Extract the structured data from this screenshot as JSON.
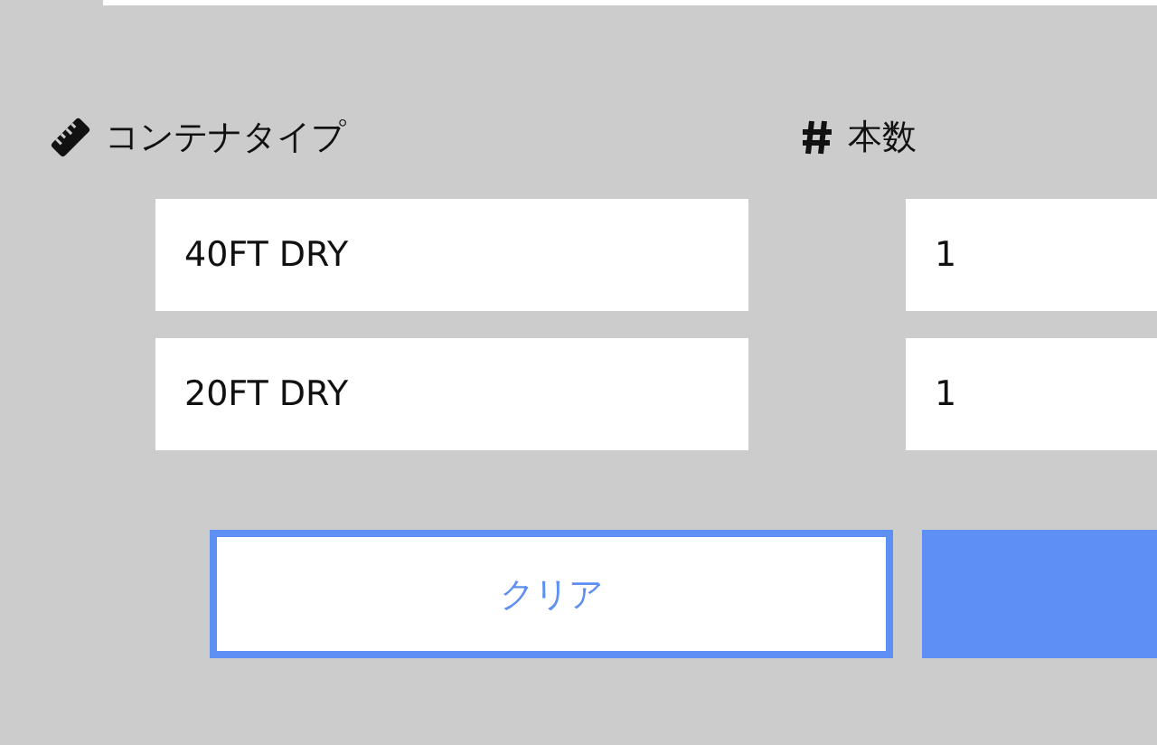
{
  "columns": [
    {
      "kind": "type",
      "label": "コンテナタイプ"
    },
    {
      "kind": "count",
      "label": "本数"
    }
  ],
  "rows": [
    {
      "type": "40FT DRY",
      "count": "1"
    },
    {
      "type": "20FT DRY",
      "count": "1"
    }
  ],
  "buttons": [
    {
      "kind": "outline",
      "label": "クリア"
    },
    {
      "kind": "filled"
    }
  ]
}
